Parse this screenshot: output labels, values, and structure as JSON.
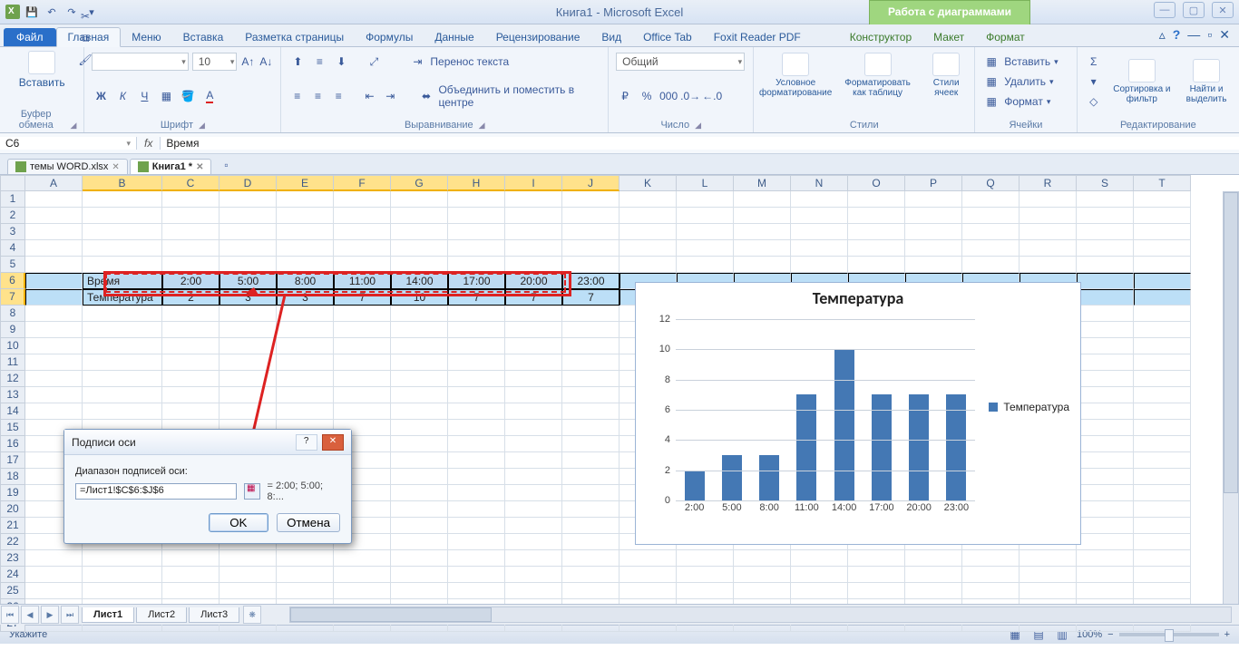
{
  "app_title": "Книга1  -  Microsoft Excel",
  "chart_tools_title": "Работа с диаграммами",
  "ribbon_tabs": {
    "file": "Файл",
    "home": "Главная",
    "menu": "Меню",
    "insert": "Вставка",
    "layout": "Разметка страницы",
    "formulas": "Формулы",
    "data": "Данные",
    "review": "Рецензирование",
    "view": "Вид",
    "office": "Office Tab",
    "foxit": "Foxit Reader PDF",
    "design": "Конструктор",
    "chart_layout": "Макет",
    "format": "Формат"
  },
  "groups": {
    "paste": "Вставить",
    "clipboard": "Буфер обмена",
    "font_name": "",
    "font_size": "10",
    "font": "Шрифт",
    "wrap": "Перенос текста",
    "merge": "Объединить и поместить в центре",
    "alignment": "Выравнивание",
    "num_format": "Общий",
    "number": "Число",
    "cond": "Условное форматирование",
    "table": "Форматировать как таблицу",
    "cell_styles": "Стили ячеек",
    "styles": "Стили",
    "ins": "Вставить",
    "del": "Удалить",
    "fmt": "Формат",
    "cells": "Ячейки",
    "sort": "Сортировка и фильтр",
    "find": "Найти и выделить",
    "editing": "Редактирование"
  },
  "name_box": "C6",
  "formula_value": "Время",
  "doc_tabs": {
    "t1": "темы WORD.xlsx",
    "t2": "Книга1 *"
  },
  "columns": [
    "A",
    "B",
    "C",
    "D",
    "E",
    "F",
    "G",
    "H",
    "I",
    "J",
    "K",
    "L",
    "M",
    "N",
    "O",
    "P",
    "Q",
    "R",
    "S",
    "T"
  ],
  "sel_cols_start": 1,
  "sel_cols_end": 9,
  "sel_rows": [
    6,
    7
  ],
  "row_count": 27,
  "table": {
    "r6_label": "Время",
    "r6_vals": [
      "2:00",
      "5:00",
      "8:00",
      "11:00",
      "14:00",
      "17:00",
      "20:00",
      "23:00"
    ],
    "r7_label": "Температура",
    "r7_vals": [
      "2",
      "3",
      "3",
      "7",
      "10",
      "7",
      "7",
      "7"
    ]
  },
  "dialog": {
    "title": "Подписи оси",
    "label": "Диапазон подписей оси:",
    "value": "=Лист1!$C$6:$J$6",
    "preview": "= 2:00; 5:00; 8:...",
    "ok": "OK",
    "cancel": "Отмена"
  },
  "sheets": {
    "s1": "Лист1",
    "s2": "Лист2",
    "s3": "Лист3"
  },
  "status_left": "Укажите",
  "zoom_pct": "100%",
  "chart_legend": "Температура",
  "chart_title": "Температура",
  "chart_data": {
    "type": "bar",
    "title": "Температура",
    "categories": [
      "2:00",
      "5:00",
      "8:00",
      "11:00",
      "14:00",
      "17:00",
      "20:00",
      "23:00"
    ],
    "series": [
      {
        "name": "Температура",
        "values": [
          2,
          3,
          3,
          7,
          10,
          7,
          7,
          7
        ]
      }
    ],
    "ylabel": "",
    "xlabel": "",
    "ylim": [
      0,
      12
    ],
    "ytick": 2
  }
}
